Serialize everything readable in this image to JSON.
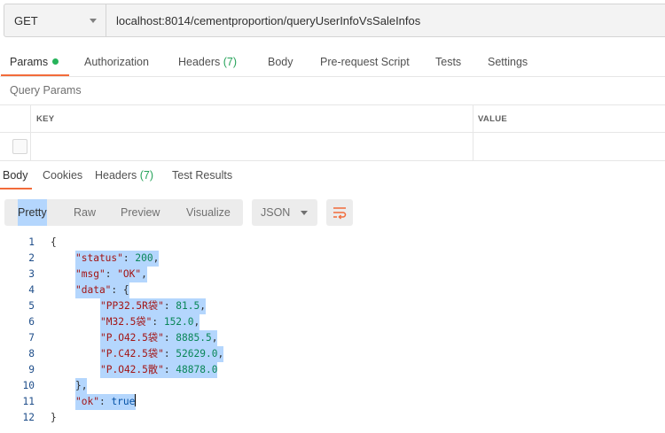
{
  "request": {
    "method": "GET",
    "url": "localhost:8014/cementproportion/queryUserInfoVsSaleInfos"
  },
  "request_tabs": {
    "params": "Params",
    "authorization": "Authorization",
    "headers": "Headers",
    "headers_count": "(7)",
    "body": "Body",
    "prerequest": "Pre-request Script",
    "tests": "Tests",
    "settings": "Settings"
  },
  "query_params": {
    "title": "Query Params",
    "key_header": "KEY",
    "value_header": "VALUE"
  },
  "response_tabs": {
    "body": "Body",
    "cookies": "Cookies",
    "headers": "Headers",
    "headers_count": "(7)",
    "test_results": "Test Results"
  },
  "view": {
    "pretty": "Pretty",
    "raw": "Raw",
    "preview": "Preview",
    "visualize": "Visualize",
    "format": "JSON"
  },
  "code_lines": [
    {
      "num": "1",
      "text": "{"
    },
    {
      "num": "2",
      "text": "\"status\": 200,"
    },
    {
      "num": "3",
      "text": "\"msg\": \"OK\","
    },
    {
      "num": "4",
      "text": "\"data\": {"
    },
    {
      "num": "5",
      "text": "\"PP32.5R袋\": 81.5,"
    },
    {
      "num": "6",
      "text": "\"M32.5袋\": 152.0,"
    },
    {
      "num": "7",
      "text": "\"P.O42.5袋\": 8885.5,"
    },
    {
      "num": "8",
      "text": "\"P.C42.5袋\": 52629.0,"
    },
    {
      "num": "9",
      "text": "\"P.O42.5散\": 48878.0"
    },
    {
      "num": "10",
      "text": "},"
    },
    {
      "num": "11",
      "text": "\"ok\": true"
    },
    {
      "num": "12",
      "text": "}"
    }
  ],
  "colors": {
    "accent": "#f26b3a",
    "count_green": "#26a35a",
    "selection": "#b4d6fd"
  }
}
